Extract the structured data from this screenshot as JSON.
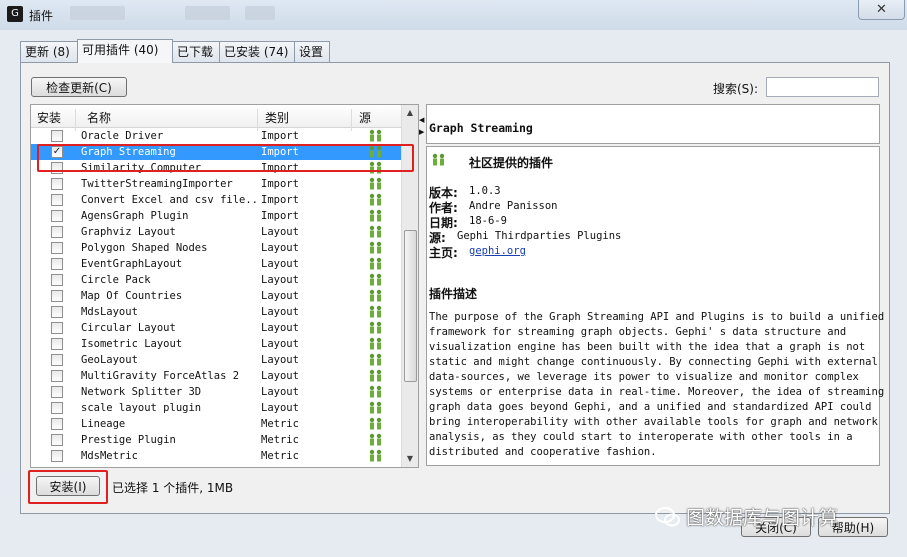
{
  "window": {
    "title": "插件",
    "close_label": "✕"
  },
  "tabs": [
    {
      "label": "更新 (8)"
    },
    {
      "label": "可用插件 (40)",
      "active": true
    },
    {
      "label": "已下载"
    },
    {
      "label": "已安装 (74)"
    },
    {
      "label": "设置"
    }
  ],
  "toolbar": {
    "check_updates_label": "检查更新(C)",
    "search_label": "搜索(S):",
    "search_value": ""
  },
  "table": {
    "columns": [
      "安装",
      "名称",
      "类别",
      "源"
    ],
    "rows": [
      {
        "checked": false,
        "name": "Oracle Driver",
        "category": "Import",
        "source_icon": "community-icon"
      },
      {
        "checked": true,
        "name": "Graph Streaming",
        "category": "Import",
        "source_icon": "community-icon",
        "selected": true
      },
      {
        "checked": false,
        "name": "Similarity Computer",
        "category": "Import",
        "source_icon": "community-icon"
      },
      {
        "checked": false,
        "name": "TwitterStreamingImporter",
        "category": "Import",
        "source_icon": "community-icon"
      },
      {
        "checked": false,
        "name": "Convert Excel and csv file...",
        "category": "Import",
        "source_icon": "community-icon"
      },
      {
        "checked": false,
        "name": "AgensGraph Plugin",
        "category": "Import",
        "source_icon": "community-icon"
      },
      {
        "checked": false,
        "name": "Graphviz Layout",
        "category": "Layout",
        "source_icon": "community-icon"
      },
      {
        "checked": false,
        "name": "Polygon Shaped Nodes",
        "category": "Layout",
        "source_icon": "community-icon"
      },
      {
        "checked": false,
        "name": "EventGraphLayout",
        "category": "Layout",
        "source_icon": "community-icon"
      },
      {
        "checked": false,
        "name": "Circle Pack",
        "category": "Layout",
        "source_icon": "community-icon"
      },
      {
        "checked": false,
        "name": "Map Of Countries",
        "category": "Layout",
        "source_icon": "community-icon"
      },
      {
        "checked": false,
        "name": "MdsLayout",
        "category": "Layout",
        "source_icon": "community-icon"
      },
      {
        "checked": false,
        "name": "Circular Layout",
        "category": "Layout",
        "source_icon": "community-icon"
      },
      {
        "checked": false,
        "name": "Isometric Layout",
        "category": "Layout",
        "source_icon": "community-icon"
      },
      {
        "checked": false,
        "name": "GeoLayout",
        "category": "Layout",
        "source_icon": "community-icon"
      },
      {
        "checked": false,
        "name": "MultiGravity ForceAtlas 2",
        "category": "Layout",
        "source_icon": "community-icon"
      },
      {
        "checked": false,
        "name": "Network Splitter 3D",
        "category": "Layout",
        "source_icon": "community-icon"
      },
      {
        "checked": false,
        "name": "scale layout plugin",
        "category": "Layout",
        "source_icon": "community-icon"
      },
      {
        "checked": false,
        "name": "Lineage",
        "category": "Metric",
        "source_icon": "community-icon"
      },
      {
        "checked": false,
        "name": "Prestige Plugin",
        "category": "Metric",
        "source_icon": "community-icon"
      },
      {
        "checked": false,
        "name": "MdsMetric",
        "category": "Metric",
        "source_icon": "community-icon"
      }
    ]
  },
  "detail": {
    "title": "Graph Streaming",
    "provider_label": "社区提供的插件",
    "version_label": "版本:",
    "version": "1.0.3",
    "author_label": "作者:",
    "author": "Andre Panisson",
    "date_label": "日期:",
    "date": "18-6-9",
    "source_label": "源:",
    "source": "Gephi Thirdparties Plugins",
    "homepage_label": "主页:",
    "homepage": "gephi.org",
    "description_heading": "插件描述",
    "description": "The purpose of the Graph Streaming API and Plugins is to build a unified\nframework for streaming graph objects. Gephi' s data structure and\nvisualization engine has been built with the idea that a graph is not\nstatic and might change continuously. By connecting Gephi with external\ndata-sources, we leverage its power to visualize and monitor complex\nsystems or enterprise data in real-time. Moreover, the idea of streaming\ngraph data goes beyond Gephi, and a unified and standardized API could\nbring interoperability with other available tools for graph and network\nanalysis, as they could start to interoperate with other tools in a\ndistributed and cooperative fashion."
  },
  "footer": {
    "install_label": "安装(I)",
    "status_text": "已选择 1 个插件, 1MB",
    "close_label": "关闭(C)",
    "help_label": "帮助(H)"
  },
  "watermark": {
    "text": "图数据库与图计算"
  },
  "colors": {
    "selection": "#3399ff",
    "highlight_box": "#e02020",
    "link": "#1a3fb0"
  }
}
